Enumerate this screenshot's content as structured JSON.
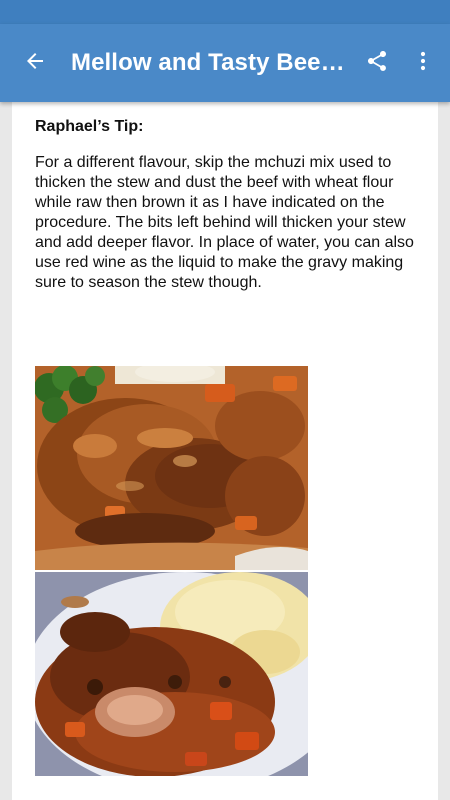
{
  "toolbar": {
    "title": "Mellow and Tasty Beef Stew",
    "back_icon": "arrow-left-icon",
    "share_icon": "share-icon",
    "more_icon": "more-vert-icon"
  },
  "article": {
    "tip_heading": "Raphael’s Tip:",
    "tip_body": "For a different flavour, skip the mchuzi mix used to thicken the stew and dust the beef with wheat flour while raw then brown it as I have indicated on the procedure. The bits left behind will thicken your stew and add deeper flavor. In place of water, you can also use red wine as the liquid to make the gravy making sure to season the stew though."
  },
  "colors": {
    "toolbar": "#4a89c8",
    "statusbar": "#3f7fbf",
    "page_bg": "#e8e8e8",
    "card_bg": "#ffffff"
  }
}
